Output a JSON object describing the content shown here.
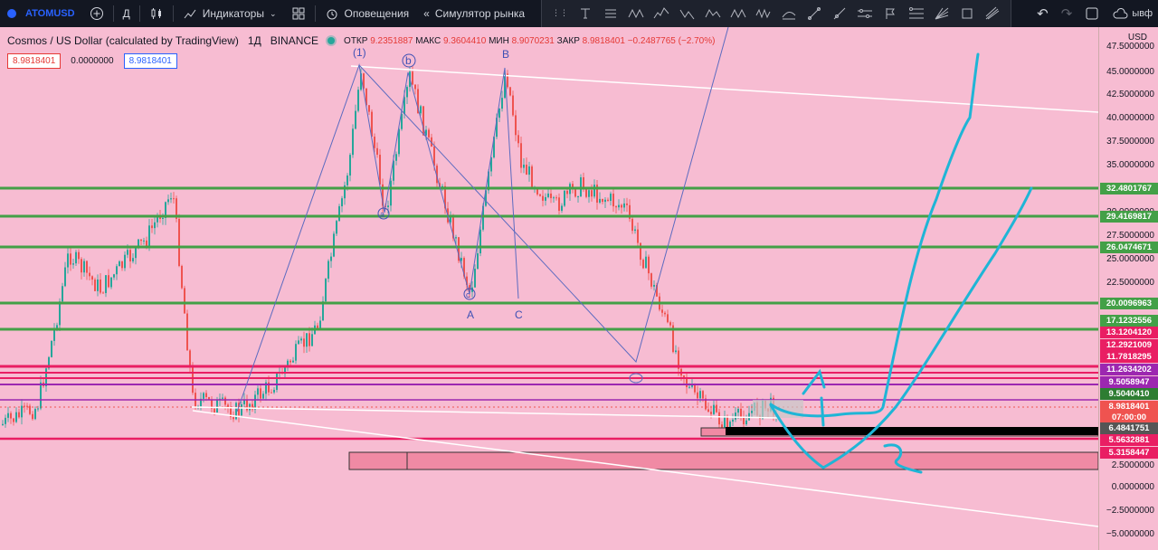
{
  "toolbar": {
    "symbol": "ATOMUSD",
    "interval": "Д",
    "indicators_label": "Индикаторы",
    "alerts_label": "Оповещения",
    "replay_label": "Симулятор рынка",
    "layout_label": "ывф"
  },
  "legend": {
    "title": "Cosmos / US Dollar (calculated by TradingView)",
    "interval": "1Д",
    "exchange": "BINANCE",
    "open_label": "ОТКР",
    "open": "9.2351887",
    "high_label": "МАКС",
    "high": "9.3604410",
    "low_label": "МИН",
    "low": "8.9070231",
    "close_label": "ЗАКР",
    "close": "8.9818401",
    "change": "−0.2487765 (−2.70%)",
    "box_left": "8.9818401",
    "box_mid": "0.0000000",
    "box_right": "8.9818401"
  },
  "scale": {
    "currency": "USD",
    "ticks": [
      "47.5000000",
      "45.0000000",
      "42.5000000",
      "40.0000000",
      "37.5000000",
      "35.0000000",
      "32.5000000",
      "30.0000000",
      "27.5000000",
      "25.0000000",
      "22.5000000",
      "20.0000000",
      "2.5000000",
      "0.0000000",
      "−2.5000000",
      "−5.0000000"
    ],
    "tags": [
      {
        "text": "32.4801767",
        "color": "#43a047"
      },
      {
        "text": "29.4169817",
        "color": "#43a047"
      },
      {
        "text": "26.0474671",
        "color": "#43a047"
      },
      {
        "text": "20.0096963",
        "color": "#43a047"
      },
      {
        "text": "17.1232556",
        "color": "#43a047"
      },
      {
        "text": "13.1204120",
        "color": "#e91e63"
      },
      {
        "text": "12.2921009",
        "color": "#e91e63"
      },
      {
        "text": "11.7818295",
        "color": "#e91e63"
      },
      {
        "text": "11.2634202",
        "color": "#9c27b0"
      },
      {
        "text": "9.5058947",
        "color": "#9c27b0"
      },
      {
        "text": "9.5040410",
        "color": "#2e7d32"
      },
      {
        "text": "8.9818401",
        "color": "#ef5350"
      },
      {
        "text": "07:00:00",
        "color": "#ef5350"
      },
      {
        "text": "6.4841751",
        "color": "#555555"
      },
      {
        "text": "5.5632881",
        "color": "#e91e63"
      },
      {
        "text": "5.3158447",
        "color": "#e91e63"
      }
    ]
  },
  "wave_labels": {
    "w1": "(1)",
    "wb": "b",
    "wB": "B",
    "wA": "A",
    "wC": "C",
    "wa": "a",
    "wc": "c"
  },
  "colors": {
    "background": "#f7bcd2",
    "toolbar": "#131722",
    "up": "#26a69a",
    "down": "#ef5350",
    "support": "#43a047",
    "resistance": "#e91e63",
    "drawing": "#1fb5d6"
  }
}
